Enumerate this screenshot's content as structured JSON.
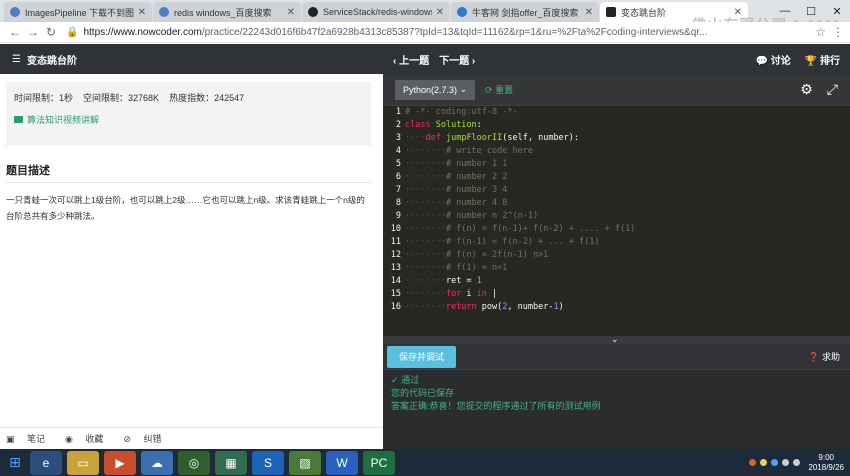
{
  "browser": {
    "tabs": [
      {
        "label": "ImagesPipeline 下载不到图片_",
        "active": false
      },
      {
        "label": "redis windows_百度搜索",
        "active": false
      },
      {
        "label": "ServiceStack/redis-windows:",
        "active": false
      },
      {
        "label": "牛客网 剑指offer_百度搜索",
        "active": false
      },
      {
        "label": "变态跳台阶",
        "active": true
      }
    ],
    "url_host": "https://www.nowcoder.com",
    "url_path": "/practice/22243d016f6b47f2a6928b4313c85387?tpId=13&tqId=11162&rp=1&ru=%2Fta%2Fcoding-interviews&qr..."
  },
  "watermark": "佛山有限公司 1.1111",
  "problem": {
    "title": "变态跳台阶",
    "time_limit": "时间限制：1秒",
    "space_limit": "空间限制：32768K",
    "heat": "热度指数：242547",
    "knowledge_link": "算法知识视频讲解",
    "section_title": "题目描述",
    "description": "一只青蛙一次可以跳上1级台阶，也可以跳上2级……它也可以跳上n级。求该青蛙跳上一个n级的台阶总共有多少种跳法。"
  },
  "left_footer": {
    "notes": "笔记",
    "favorite": "收藏",
    "report": "纠错"
  },
  "nav": {
    "prev": "上一题",
    "next": "下一题",
    "discuss": "讨论",
    "rank": "排行"
  },
  "editor": {
    "language": "Python(2.7.3)",
    "reset": "重置",
    "lines": [
      "# -*- coding:utf-8 -*-",
      "class Solution:",
      "    def jumpFloorII(self, number):",
      "        # write code here",
      "        # number 1 1",
      "        # number 2 2",
      "        # number 3 4",
      "        # number 4 8",
      "        # number n 2^(n-1)",
      "        # f(n) = f(n-1)+ f(n-2) + .... + f(1)",
      "        # f(n-1) = f(n-2) + ... + f(1)",
      "        # f(n) = 2f(n-1) n>1",
      "        # f(1) = n=1",
      "        ret = 1",
      "        for i in |",
      "        return pow(2, number-1)"
    ]
  },
  "actions": {
    "run": "保存并调试",
    "help": "求助"
  },
  "result": {
    "status": "通过",
    "saved": "您的代码已保存",
    "message": "答案正确:恭喜！您提交的程序通过了所有的测试用例"
  },
  "taskbar": {
    "time": "9:00",
    "date": "2018/9/26"
  }
}
